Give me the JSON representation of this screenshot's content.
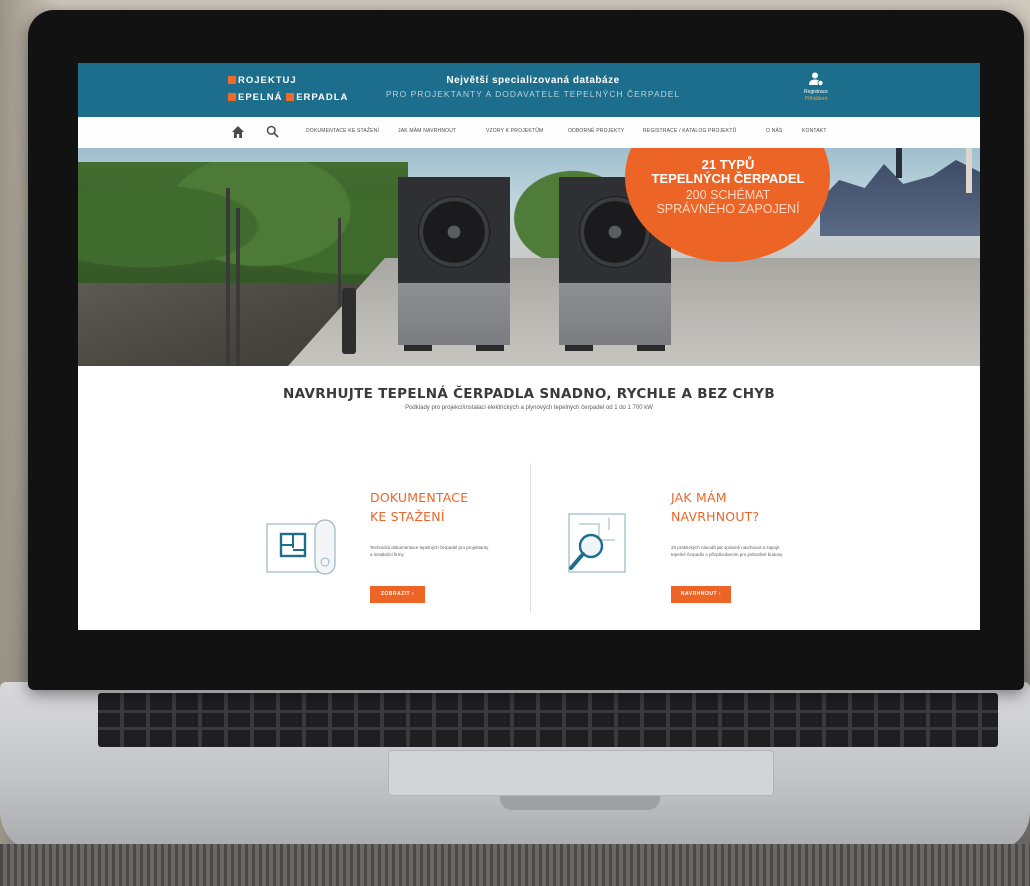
{
  "colors": {
    "header_blue": "#1c6e8c",
    "accent_orange": "#ec6526"
  },
  "header": {
    "logo_line1": "ROJEKTUJ",
    "logo_line2_a": "EPELNÁ",
    "logo_line2_b": "ERPADLA",
    "tagline_main": "Největší specializovaná databáze",
    "tagline_sub": "PRO PROJEKTANTY A DODAVATELE TEPELNÝCH ČERPADEL",
    "user_icon": "user-plus-icon",
    "user_line1": "Registrace",
    "user_line2": "Přihlášení"
  },
  "nav": {
    "home_icon": "home-icon",
    "search_icon": "search-icon",
    "items": [
      "DOKUMENTACE KE STAŽENÍ",
      "JAK MÁM NAVRHNOUT",
      "VZORY K PROJEKTŮM",
      "ODBORNÉ PROJEKTY",
      "REGISTRACE / KATALOG PROJEKTŮ",
      "O NÁS",
      "KONTAKT"
    ]
  },
  "hero": {
    "promo_line1": "21 TYPŮ",
    "promo_line2": "TEPELNÝCH ČERPADEL",
    "promo_line3": "200 SCHÉMAT",
    "promo_line4": "SPRÁVNÉHO ZAPOJENÍ"
  },
  "main": {
    "title": "NAVRHUJTE TEPELNÁ ČERPADLA SNADNO, RYCHLE A BEZ CHYB",
    "subtitle": "Podklady pro projekci/instalaci elektrických a plynových tepelných čerpadel od 1 do 1 700 kW"
  },
  "cards": [
    {
      "icon": "blueprint-icon",
      "title_line1": "DOKUMENTACE",
      "title_line2": "KE STAŽENÍ",
      "text": "Technická dokumentace tepelných čerpadel pro projektanty a instalační firmy",
      "button": "ZOBRAZIT ›"
    },
    {
      "icon": "magnifier-plan-icon",
      "title_line1": "JAK MÁM",
      "title_line2": "NAVRHNOUT?",
      "text": "20 praktických návodů jak správně navrhnout a zapojit tepelné čerpadlo s přizpůsobením pro jednotlivé budovy",
      "button": "NAVRHNOUT ›"
    }
  ]
}
